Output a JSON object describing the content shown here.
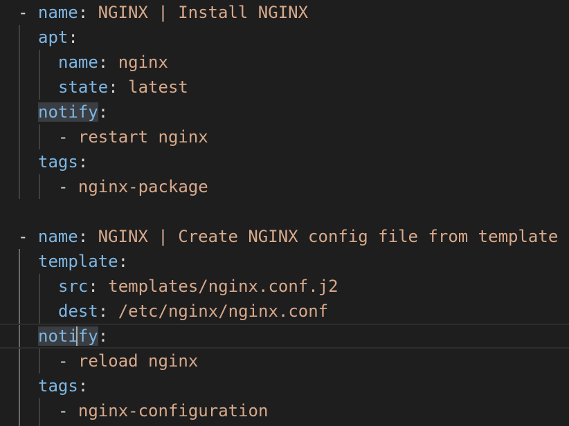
{
  "editor": {
    "language": "yaml",
    "colors": {
      "background": "#1e1e1e",
      "key": "#7eb6e4",
      "string": "#d7a98b",
      "punctuation": "#d4d4d4",
      "highlight": "#3a3d41"
    },
    "lines": [
      {
        "dash": "- ",
        "key": "name",
        "colon": ":",
        "value": " NGINX | Install NGINX"
      },
      {
        "key": "apt",
        "colon": ":"
      },
      {
        "key": "name",
        "colon": ":",
        "value": " nginx"
      },
      {
        "key": "state",
        "colon": ":",
        "value": " latest"
      },
      {
        "key": "notify",
        "colon": ":",
        "highlighted": true
      },
      {
        "dash": "- ",
        "value": "restart nginx"
      },
      {
        "key": "tags",
        "colon": ":"
      },
      {
        "dash": "- ",
        "value": "nginx-package"
      },
      {},
      {
        "dash": "- ",
        "key": "name",
        "colon": ":",
        "value": " NGINX | Create NGINX config file from template"
      },
      {
        "key": "template",
        "colon": ":"
      },
      {
        "key": "src",
        "colon": ":",
        "value": " templates/nginx.conf.j2"
      },
      {
        "key": "dest",
        "colon": ":",
        "value": " /etc/nginx/nginx.conf"
      },
      {
        "key": "notify",
        "colon": ":",
        "highlighted": true,
        "current_line": true
      },
      {
        "dash": "- ",
        "value": "reload nginx"
      },
      {
        "key": "tags",
        "colon": ":"
      },
      {
        "dash": "- ",
        "value": "nginx-configuration"
      }
    ]
  }
}
